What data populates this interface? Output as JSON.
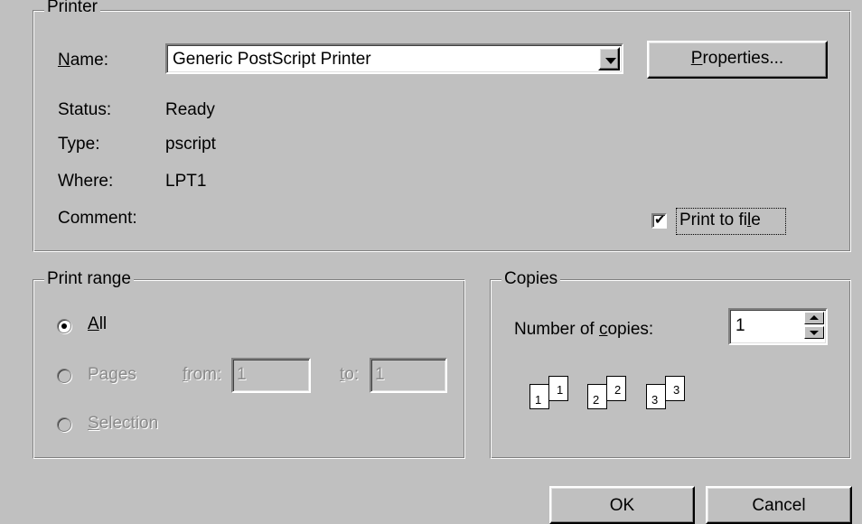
{
  "printer": {
    "legend": "Printer",
    "name_label_u": "N",
    "name_label_rest": "ame:",
    "name_value": "Generic PostScript Printer",
    "properties_u": "P",
    "properties_rest": "roperties...",
    "status_label": "Status:",
    "status_value": "Ready",
    "type_label": "Type:",
    "type_value": "pscript",
    "where_label": "Where:",
    "where_value": "LPT1",
    "comment_label": "Comment:",
    "print_to_file_pre": "Print to fi",
    "print_to_file_u": "l",
    "print_to_file_post": "e",
    "print_to_file_checked": true
  },
  "range": {
    "legend": "Print range",
    "all_u": "A",
    "all_rest": "ll",
    "pages_pre": "Pa",
    "pages_u": "g",
    "pages_post": "es",
    "from_u": "f",
    "from_rest": "rom:",
    "from_value": "1",
    "to_u": "t",
    "to_rest": "o:",
    "to_value": "1",
    "selection_u": "S",
    "selection_rest": "election",
    "selected": "All"
  },
  "copies": {
    "legend": "Copies",
    "number_pre": "Number of ",
    "number_u": "c",
    "number_post": "opies:",
    "value": "1",
    "collate_pages": [
      "1",
      "1",
      "2",
      "2",
      "3",
      "3"
    ]
  },
  "buttons": {
    "ok": "OK",
    "cancel": "Cancel"
  }
}
